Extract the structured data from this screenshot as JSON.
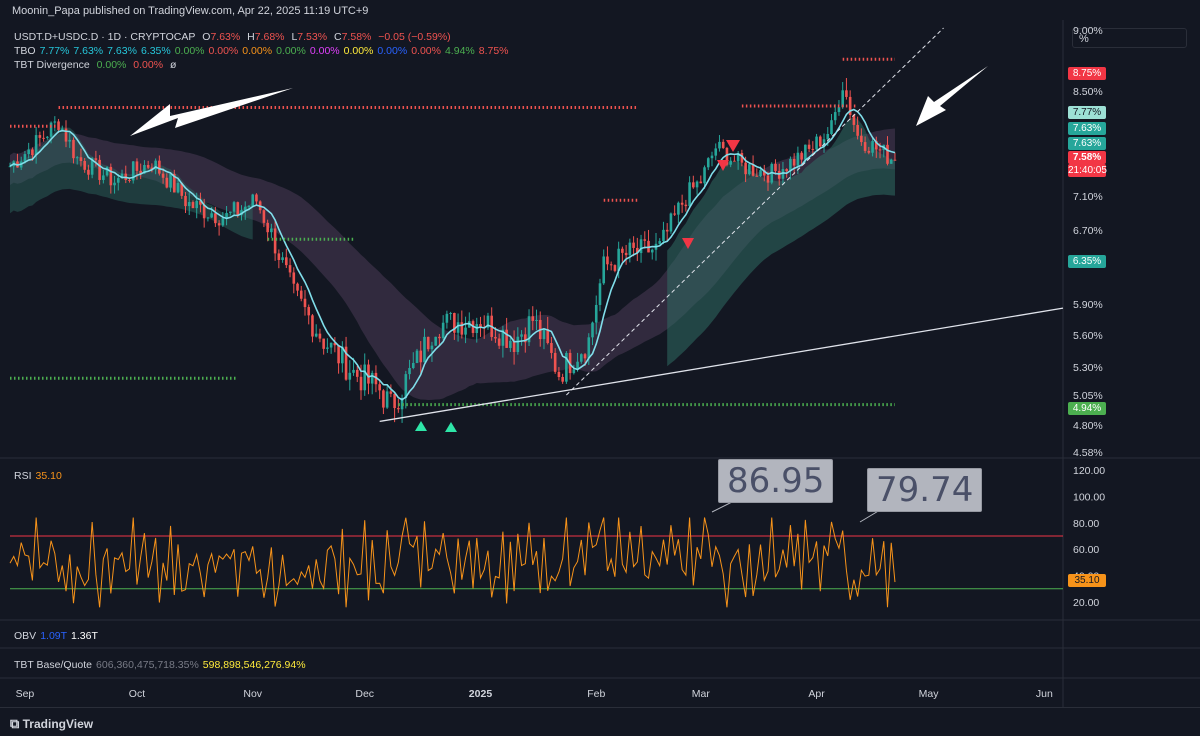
{
  "header": {
    "publisher": "Moonin_Papa published on TradingView.com, Apr 22, 2025 11:19 UTC+9"
  },
  "legend_main": {
    "symbol": "USDT.D+USDC.D · 1D · CRYPTOCAP",
    "o_label": "O",
    "o": "7.63%",
    "h_label": "H",
    "h": "7.68%",
    "l_label": "L",
    "l": "7.53%",
    "c_label": "C",
    "c": "7.58%",
    "chg": "−0.05 (−0.59%)"
  },
  "legend_tbo": {
    "name": "TBO",
    "values": [
      {
        "v": "7.77%",
        "color": "#26c6da"
      },
      {
        "v": "7.63%",
        "color": "#26c6da"
      },
      {
        "v": "7.63%",
        "color": "#26c6da"
      },
      {
        "v": "6.35%",
        "color": "#26c6da"
      },
      {
        "v": "0.00%",
        "color": "#4caf50"
      },
      {
        "v": "0.00%",
        "color": "#ef5350"
      },
      {
        "v": "0.00%",
        "color": "#f7931a"
      },
      {
        "v": "0.00%",
        "color": "#4caf50"
      },
      {
        "v": "0.00%",
        "color": "#e040fb"
      },
      {
        "v": "0.00%",
        "color": "#ffeb3b"
      },
      {
        "v": "0.00%",
        "color": "#2962ff"
      },
      {
        "v": "0.00%",
        "color": "#ef5350"
      },
      {
        "v": "4.94%",
        "color": "#4caf50"
      },
      {
        "v": "8.75%",
        "color": "#ef5350"
      }
    ]
  },
  "legend_div": {
    "name": "TBT Divergence",
    "v1": "0.00%",
    "v2": "0.00%",
    "v3": "ø"
  },
  "scale_mode": "%",
  "price_axis": [
    "9.00%",
    "8.50%",
    "7.10%",
    "6.70%",
    "5.90%",
    "5.60%",
    "5.30%",
    "5.05%",
    "4.80%",
    "4.58%"
  ],
  "price_badges": {
    "top": "8.75%",
    "tbo1": "7.77%",
    "tbo2": "7.63%",
    "tbo3": "7.63%",
    "last": "7.58%",
    "countdown": "21:40:05",
    "tbo4": "6.35%",
    "bottom": "4.94%"
  },
  "rsi": {
    "label": "RSI",
    "value": "35.10",
    "axis": [
      "120.00",
      "100.00",
      "80.00",
      "60.00",
      "40.00",
      "20.00"
    ],
    "callout1": "86.95",
    "callout2": "79.74"
  },
  "obv": {
    "label": "OBV",
    "v1": "1.09T",
    "v2": "1.36T"
  },
  "tbt": {
    "label": "TBT Base/Quote",
    "v1": "606,360,475,718.35%",
    "v2": "598,898,546,276.94%"
  },
  "time_axis": [
    "Sep",
    "Oct",
    "Nov",
    "Dec",
    "2025",
    "Feb",
    "Mar",
    "Apr",
    "May",
    "Jun"
  ],
  "brand": "TradingView",
  "colors": {
    "up": "#26a69a",
    "down": "#ef5350",
    "bg": "#131722",
    "rsi": "#f7931a",
    "tbo_fast": "#80deea",
    "tbo_slow": "#f48fb1"
  },
  "chart_data": {
    "type": "candlestick",
    "title": "USDT.D+USDC.D · 1D · CRYPTOCAP",
    "ylabel": "%",
    "ylim": [
      4.58,
      9.0
    ],
    "x_range": [
      "2024-08-28",
      "2025-04-22"
    ],
    "close_path": [
      [
        "2024-08-28",
        7.5
      ],
      [
        "2024-09-05",
        7.85
      ],
      [
        "2024-09-10",
        8.1
      ],
      [
        "2024-09-15",
        7.6
      ],
      [
        "2024-09-25",
        7.3
      ],
      [
        "2024-10-05",
        7.55
      ],
      [
        "2024-10-15",
        7.0
      ],
      [
        "2024-10-25",
        6.85
      ],
      [
        "2024-11-02",
        7.05
      ],
      [
        "2024-11-07",
        6.55
      ],
      [
        "2024-11-12",
        6.0
      ],
      [
        "2024-11-20",
        5.55
      ],
      [
        "2024-11-28",
        5.25
      ],
      [
        "2024-12-05",
        5.1
      ],
      [
        "2024-12-08",
        4.95
      ],
      [
        "2024-12-15",
        5.35
      ],
      [
        "2024-12-20",
        5.7
      ],
      [
        "2025-01-01",
        5.75
      ],
      [
        "2025-01-10",
        5.55
      ],
      [
        "2025-01-15",
        5.75
      ],
      [
        "2025-01-22",
        5.25
      ],
      [
        "2025-01-30",
        5.55
      ],
      [
        "2025-02-03",
        6.3
      ],
      [
        "2025-02-10",
        6.45
      ],
      [
        "2025-02-18",
        6.5
      ],
      [
        "2025-02-25",
        7.1
      ],
      [
        "2025-03-01",
        7.3
      ],
      [
        "2025-03-05",
        7.75
      ],
      [
        "2025-03-12",
        7.5
      ],
      [
        "2025-03-20",
        7.4
      ],
      [
        "2025-03-30",
        7.7
      ],
      [
        "2025-04-05",
        8.0
      ],
      [
        "2025-04-08",
        8.6
      ],
      [
        "2025-04-12",
        7.9
      ],
      [
        "2025-04-18",
        7.7
      ],
      [
        "2025-04-22",
        7.58
      ]
    ],
    "last": {
      "open": 7.63,
      "high": 7.68,
      "low": 7.53,
      "close": 7.58
    },
    "rsi_last": 35.1,
    "rsi_peaks": [
      86.95,
      79.74
    ]
  }
}
